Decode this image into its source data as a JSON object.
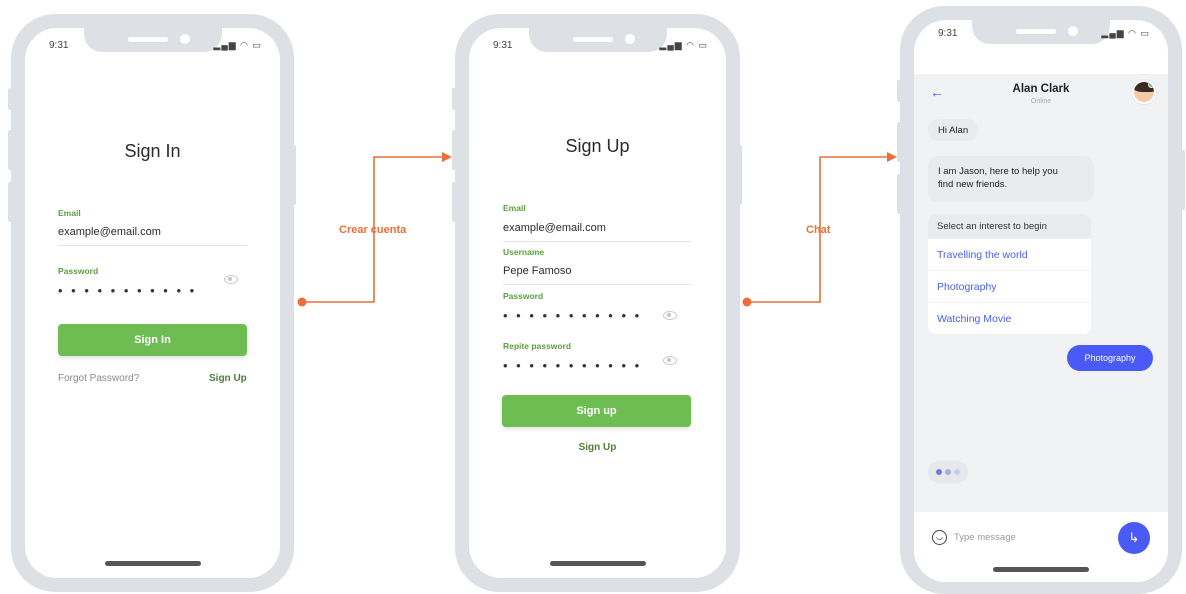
{
  "colors": {
    "accent_green": "#6dbd52",
    "label_green": "#5c9e3e",
    "connector_orange": "#e8703a",
    "chat_blue": "#4a5bf5",
    "phone_frame": "#dde1e6"
  },
  "status_bar": {
    "time_1": "9:31",
    "time_2": "9:31",
    "time_3": "9:31"
  },
  "connectors": {
    "first_label": "Crear cuenta",
    "second_label": "Chat"
  },
  "signin": {
    "title": "Sign In",
    "email_label": "Email",
    "email_value": "example@email.com",
    "password_label": "Password",
    "password_value": "• • • • • • • • • • •",
    "button_label": "Sign In",
    "forgot_link": "Forgot Password?",
    "signup_link": "Sign Up"
  },
  "signup": {
    "title": "Sign Up",
    "email_label": "Email",
    "email_value": "example@email.com",
    "username_label": "Username",
    "username_value": "Pepe Famoso",
    "password_label": "Password",
    "password_value": "• • • • • • • • • • •",
    "repeat_label": "Repite password",
    "repeat_value": "• • • • • • • • • • •",
    "button_label": "Sign up",
    "signup_link": "Sign Up"
  },
  "chat": {
    "contact_name": "Alan Clark",
    "contact_status": "Online",
    "greeting": "Hi Alan",
    "intro_line1": "I am Jason, here to help you",
    "intro_line2": "find new friends.",
    "interest_prompt": "Select an interest to begin",
    "interests": [
      "Travelling the world",
      "Photography",
      "Watching Movie"
    ],
    "selected_reply": "Photography",
    "input_placeholder": "Type message",
    "icons": {
      "back": "back-arrow-icon",
      "emoji": "smile-icon",
      "send": "send-icon"
    }
  }
}
